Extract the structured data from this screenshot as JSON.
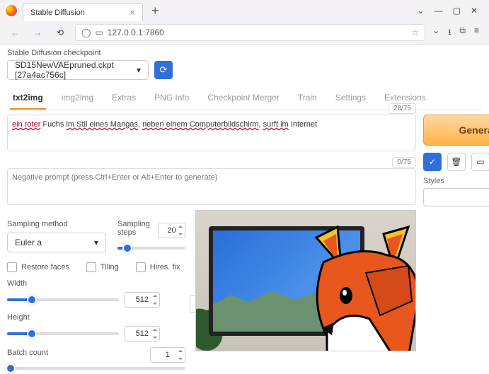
{
  "browser": {
    "tab_title": "Stable Diffusion",
    "url": "127.0.0.1:7860",
    "win_min": "—",
    "win_max": "▢",
    "win_close": "✕",
    "chevron": "⌄"
  },
  "checkpoint": {
    "label": "Stable Diffusion checkpoint",
    "value": "SD15NewVAEpruned.ckpt [27a4ac756c]"
  },
  "tabs": [
    "txt2img",
    "img2img",
    "Extras",
    "PNG Info",
    "Checkpoint Merger",
    "Train",
    "Settings",
    "Extensions"
  ],
  "active_tab": "txt2img",
  "prompt": {
    "counter": "28/75",
    "parts": {
      "p1": "ein roter",
      "p2": " Fuchs ",
      "p3": "im Stil eines Mangas",
      "p4": ", ",
      "p5": "neben einem Computerbildschirm",
      "p6": ", ",
      "p7": "surft im",
      "p8": " Internet"
    }
  },
  "neg_prompt": {
    "counter": "0/75",
    "placeholder": "Negative prompt (press Ctrl+Enter or Alt+Enter to generate)"
  },
  "generate_label": "Generate",
  "styles_label": "Styles",
  "styles_clear": "×",
  "sampling": {
    "method_label": "Sampling method",
    "method_value": "Euler a",
    "steps_label": "Sampling steps",
    "steps_value": "20"
  },
  "checks": {
    "restore": "Restore faces",
    "tiling": "Tiling",
    "hires": "Hires. fix"
  },
  "dims": {
    "width_label": "Width",
    "width_value": "512",
    "height_label": "Height",
    "height_value": "512"
  },
  "batch": {
    "count_label": "Batch count",
    "count_value": "1"
  },
  "icons": {
    "refresh": "⟳",
    "swap": "⇅",
    "save": "✓",
    "trash": "🗑",
    "folder": "▭",
    "clip1": "📋",
    "clip2": "▫"
  }
}
